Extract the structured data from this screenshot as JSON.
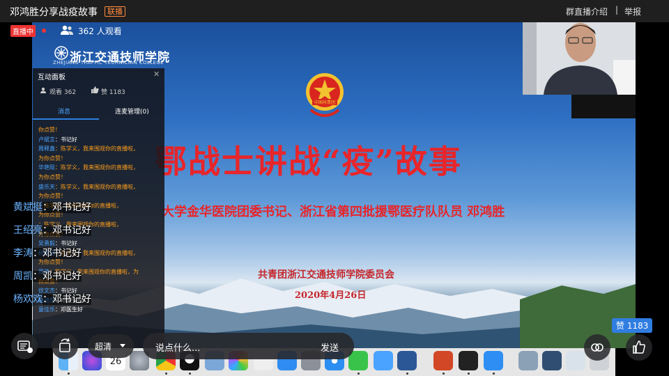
{
  "header": {
    "title": "邓鸿胜分享战疫故事",
    "tag": "联播",
    "intro_link": "群直播介绍",
    "separator": "|",
    "report_link": "举报"
  },
  "live": {
    "badge": "直播中",
    "viewers": "362 人观看"
  },
  "slide": {
    "logo_text": "浙江交通技师学院",
    "logo_sub": "ZHEJIANG TRAFFIC TECHNICIAN COLLEGE",
    "emblem_text": "中国共青团",
    "title": "鄂战士讲战“疫”故事",
    "subtitle": "大学金华医院团委书记、浙江省第四批援鄂医疗队队员 邓鸿胜",
    "org": "共青团浙江交通技师学院委员会",
    "date": "2020年4月26日"
  },
  "panel": {
    "title": "互动面板",
    "close": "✕",
    "views": "观看 362",
    "likes": "赞 1183",
    "tab_messages": "消息",
    "tab_connect": "连麦管理(0)",
    "messages": [
      {
        "user": "",
        "text": "你点赞！"
      },
      {
        "user": "卢斌言",
        "text": "：书记好"
      },
      {
        "user": "周释鑫",
        "text": "：陈学义，我来围观你的直播啦，"
      },
      {
        "user": "",
        "text": "为你点赞！"
      },
      {
        "user": "华艳现",
        "text": "：陈学义，我来围观你的直播啦，"
      },
      {
        "user": "",
        "text": "为你点赞！"
      },
      {
        "user": "盛乐天",
        "text": "：陈学义，我来围观你的直播啦，"
      },
      {
        "user": "",
        "text": "为你点赞！"
      },
      {
        "user": "",
        "text": "：陈学义，我来围观你的直播啦，"
      },
      {
        "user": "",
        "text": "为你点赞！"
      },
      {
        "user": "",
        "text": "：陈学义，我来围观你的直播啦，"
      },
      {
        "user": "",
        "text": "为你点赞！"
      },
      {
        "user": "吴勇毅",
        "text": "：书记好"
      },
      {
        "user": "杨宇涵",
        "text": "：陈学义，我来围观你的直播啦，"
      },
      {
        "user": "",
        "text": "为你点赞！"
      },
      {
        "user": "周倩",
        "text": "：陈学义，我来围观你的直播啦，为"
      },
      {
        "user": "",
        "text": "你点赞！"
      },
      {
        "user": "徐文杰",
        "text": "：书记好"
      },
      {
        "user": "赵骁然",
        "text": "：邓医生好"
      },
      {
        "user": "童佳乐",
        "text": "：邓医生好"
      }
    ]
  },
  "danmaku": [
    {
      "name": "黄斌挺",
      "text": "：邓书记好"
    },
    {
      "name": "王绍亮",
      "text": "：邓书记好"
    },
    {
      "name": "李涛",
      "text": "：邓书记好"
    },
    {
      "name": "周凯",
      "text": "：邓书记好"
    },
    {
      "name": "杨欢欢",
      "text": "：邓书记好"
    }
  ],
  "controls": {
    "quality": "超清",
    "say_placeholder": "说点什么...",
    "send": "发送",
    "like_badge": "赞 1183"
  },
  "dock": {
    "calendar_day": "26"
  }
}
